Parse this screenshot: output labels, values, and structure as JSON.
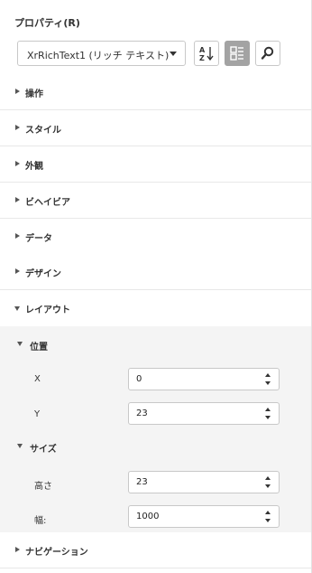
{
  "panel": {
    "title": "プロパティ(R)"
  },
  "object_selector": {
    "value": "XrRichText1 (リッチ テキスト)"
  },
  "toolbar": {
    "sort_icon": "sort-alphabetical-icon",
    "categorize_icon": "categorized-list-icon",
    "categorize_active": true,
    "search_icon": "search-icon"
  },
  "sections": [
    {
      "label": "操作",
      "expanded": false
    },
    {
      "label": "スタイル",
      "expanded": false
    },
    {
      "label": "外観",
      "expanded": false
    },
    {
      "label": "ビヘイビア",
      "expanded": false
    },
    {
      "label": "データ",
      "expanded": false
    },
    {
      "label": "デザイン",
      "expanded": false
    },
    {
      "label": "レイアウト",
      "expanded": true
    },
    {
      "label": "ナビゲーション",
      "expanded": false
    }
  ],
  "layout": {
    "position": {
      "label": "位置",
      "x_label": "X",
      "x_value": "0",
      "y_label": "Y",
      "y_value": "23"
    },
    "size": {
      "label": "サイズ",
      "height_label": "高さ",
      "height_value": "23",
      "width_label": "幅:",
      "width_value": "1000"
    }
  },
  "colors": {
    "active_button": "#a3a3a3",
    "group_background": "#f4f4f4",
    "border": "#c8c8c8"
  }
}
